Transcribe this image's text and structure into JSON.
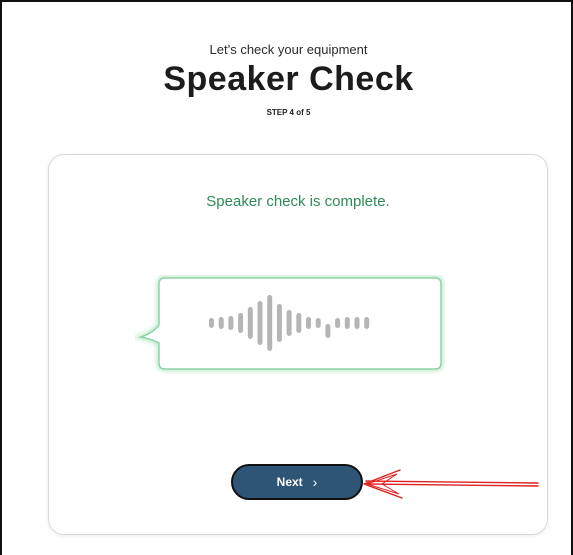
{
  "header": {
    "subtitle": "Let’s check your equipment",
    "title": "Speaker Check",
    "step": "STEP 4 of 5"
  },
  "card": {
    "status": "Speaker check is complete.",
    "next_label": "Next",
    "next_icon": "chevron-right-icon"
  },
  "colors": {
    "status_green": "#2e8b57",
    "button_blue": "#2f5576",
    "bubble_border": "#8fd3a5",
    "bars": "#b5b5b5",
    "annotation_red": "#e02020"
  }
}
